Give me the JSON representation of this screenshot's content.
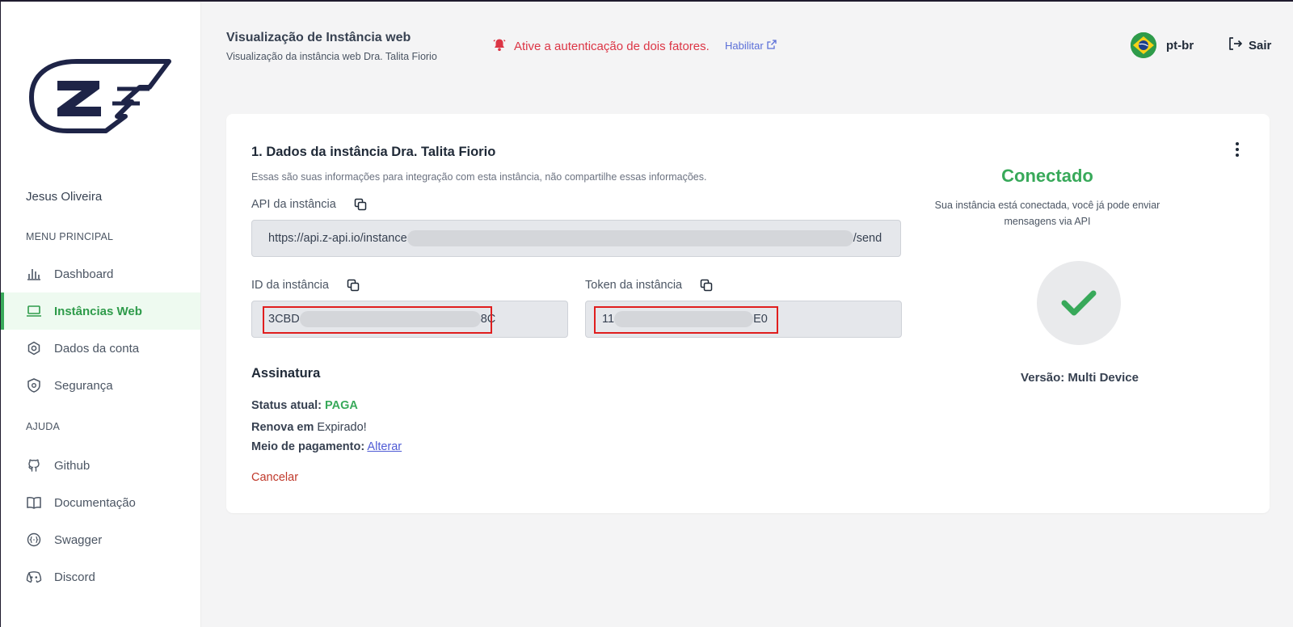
{
  "header": {
    "title": "Visualização de Instância web",
    "subtitle": "Visualização da instância web Dra. Talita Fiorio",
    "alert": "Ative a autenticação de dois fatores.",
    "enable_link": "Habilitar",
    "language": "pt-br",
    "logout": "Sair"
  },
  "sidebar": {
    "user": "Jesus Oliveira",
    "main_menu_label": "MENU PRINCIPAL",
    "main_items": [
      {
        "label": "Dashboard",
        "icon": "bar-chart-icon"
      },
      {
        "label": "Instâncias Web",
        "icon": "laptop-icon",
        "active": true
      },
      {
        "label": "Dados da conta",
        "icon": "gear-icon"
      },
      {
        "label": "Segurança",
        "icon": "shield-icon"
      }
    ],
    "help_label": "AJUDA",
    "help_items": [
      {
        "label": "Github",
        "icon": "github-icon"
      },
      {
        "label": "Documentação",
        "icon": "book-icon"
      },
      {
        "label": "Swagger",
        "icon": "swagger-icon"
      },
      {
        "label": "Discord",
        "icon": "discord-icon"
      }
    ]
  },
  "instance": {
    "title": "1. Dados da instância Dra. Talita Fiorio",
    "description": "Essas são suas informações para integração com esta instância, não compartilhe essas informações.",
    "api_label": "API da instância",
    "api_prefix": "https://api.z-api.io/instance",
    "api_suffix": "/send",
    "id_label": "ID da instância",
    "id_prefix": "3CBD",
    "id_suffix": "8C",
    "token_label": "Token da instância",
    "token_prefix": "11",
    "token_suffix": "E0"
  },
  "subscription": {
    "title": "Assinatura",
    "status_label": "Status atual:",
    "status_value": "PAGA",
    "renew_label": "Renova em",
    "renew_value": "Expirado!",
    "payment_label": "Meio de pagamento:",
    "payment_link": "Alterar",
    "cancel": "Cancelar"
  },
  "connection": {
    "status": "Conectado",
    "description": "Sua instância está conectada, você já pode enviar mensagens via API",
    "version": "Versão: Multi Device"
  },
  "colors": {
    "accent_green": "#38a95a",
    "alert_red": "#dc3545",
    "link_blue": "#5b6fd8",
    "logo_navy": "#1e2447"
  }
}
